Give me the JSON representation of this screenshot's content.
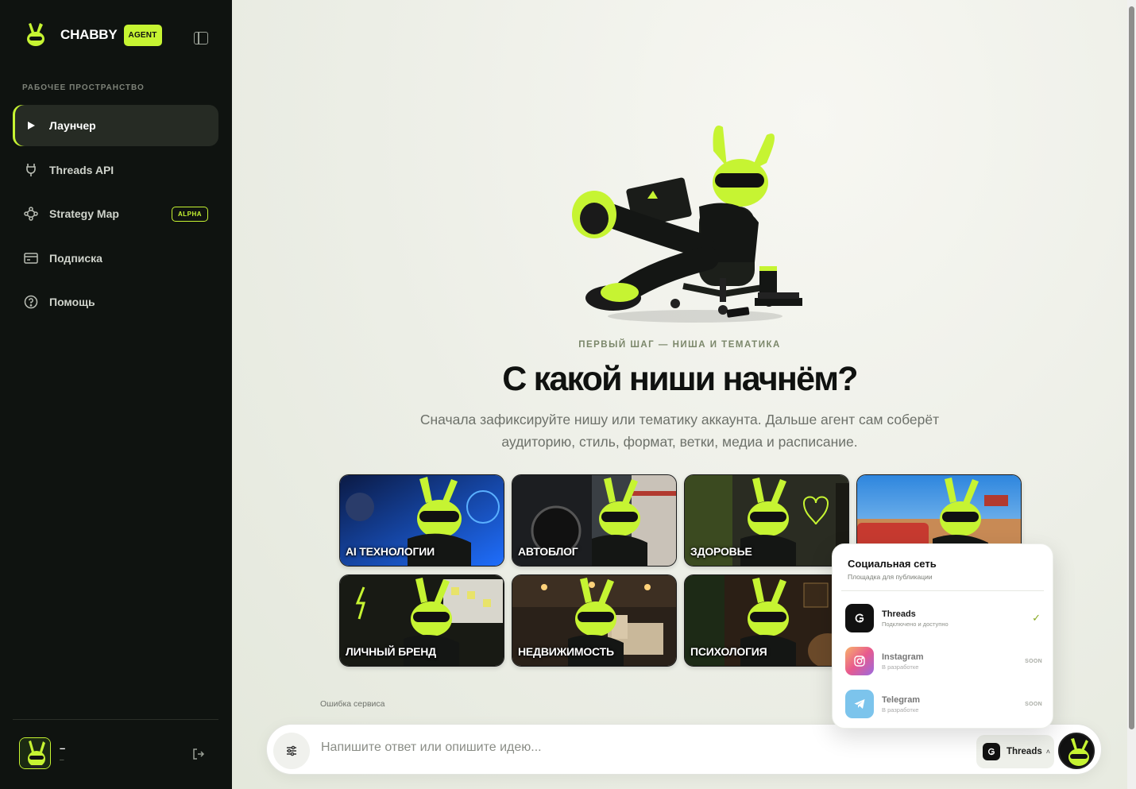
{
  "brand": {
    "name": "CHABBY",
    "badge": "AGENT"
  },
  "sidebar": {
    "section_label": "РАБОЧЕЕ ПРОСТРАНСТВО",
    "items": [
      {
        "label": "Лаунчер",
        "icon": "play-icon",
        "active": true
      },
      {
        "label": "Threads API",
        "icon": "plug-icon"
      },
      {
        "label": "Strategy Map",
        "icon": "nodes-icon",
        "badge": "ALPHA"
      },
      {
        "label": "Подписка",
        "icon": "card-icon"
      },
      {
        "label": "Помощь",
        "icon": "help-icon"
      }
    ],
    "user": {
      "name": "–",
      "sub": "–"
    }
  },
  "hero": {
    "eyebrow": "ПЕРВЫЙ ШАГ — НИША И ТЕМАТИКА",
    "title": "С какой ниши начнём?",
    "subtitle": "Сначала зафиксируйте нишу или тематику аккаунта. Дальше агент сам соберёт аудиторию, стиль, формат, ветки, медиа и расписание."
  },
  "niches": [
    {
      "label": "AI ТЕХНОЛОГИИ",
      "accent": "#1f6fff"
    },
    {
      "label": "АВТОБЛОГ",
      "accent": "#b23a2f"
    },
    {
      "label": "ЗДОРОВЬЕ",
      "accent": "#4d5a1a"
    },
    {
      "label": "",
      "accent": "#2e86de"
    },
    {
      "label": "ЛИЧНЫЙ БРЕНД",
      "accent": "#2c3a12"
    },
    {
      "label": "НЕДВИЖИМОСТЬ",
      "accent": "#6b4a2a"
    },
    {
      "label": "ПСИХОЛОГИЯ",
      "accent": "#5a3a22"
    }
  ],
  "status": {
    "error": "Ошибка сервиса"
  },
  "composer": {
    "placeholder": "Напишите ответ или опишите идею...",
    "platform": "Threads"
  },
  "popover": {
    "title": "Социальная сеть",
    "subtitle": "Площадка для публикации",
    "options": [
      {
        "name": "Threads",
        "desc": "Подключено и доступно",
        "state": "✓"
      },
      {
        "name": "Instagram",
        "desc": "В разработке",
        "state": "SOON"
      },
      {
        "name": "Telegram",
        "desc": "В разработке",
        "state": "SOON"
      }
    ]
  },
  "colors": {
    "accent": "#c6f432",
    "sidebar_bg": "#0f1310",
    "text_dark": "#101210"
  }
}
